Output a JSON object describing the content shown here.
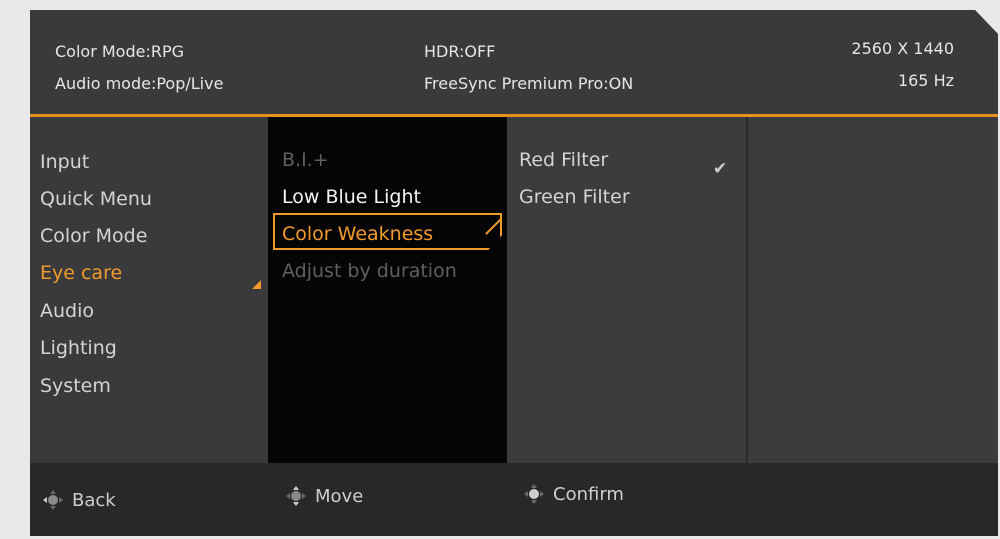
{
  "header": {
    "color_mode": "Color Mode:RPG",
    "audio_mode": "Audio mode:Pop/Live",
    "hdr": "HDR:OFF",
    "freesync": "FreeSync Premium Pro:ON",
    "resolution": "2560 X 1440",
    "refresh": "165 Hz"
  },
  "main_menu": [
    "Input",
    "Quick Menu",
    "Color Mode",
    "Eye care",
    "Audio",
    "Lighting",
    "System"
  ],
  "sub_menu": [
    "B.I.+",
    "Low Blue Light",
    "Color Weakness",
    "Adjust by duration"
  ],
  "options": [
    "Red Filter",
    "Green Filter"
  ],
  "footer": {
    "back": "Back",
    "move": "Move",
    "confirm": "Confirm"
  },
  "colors": {
    "accent": "#f39a2c",
    "orange_line": "#e8901f"
  },
  "icons": {
    "selected": "check-icon",
    "nav": "dpad-icon"
  }
}
